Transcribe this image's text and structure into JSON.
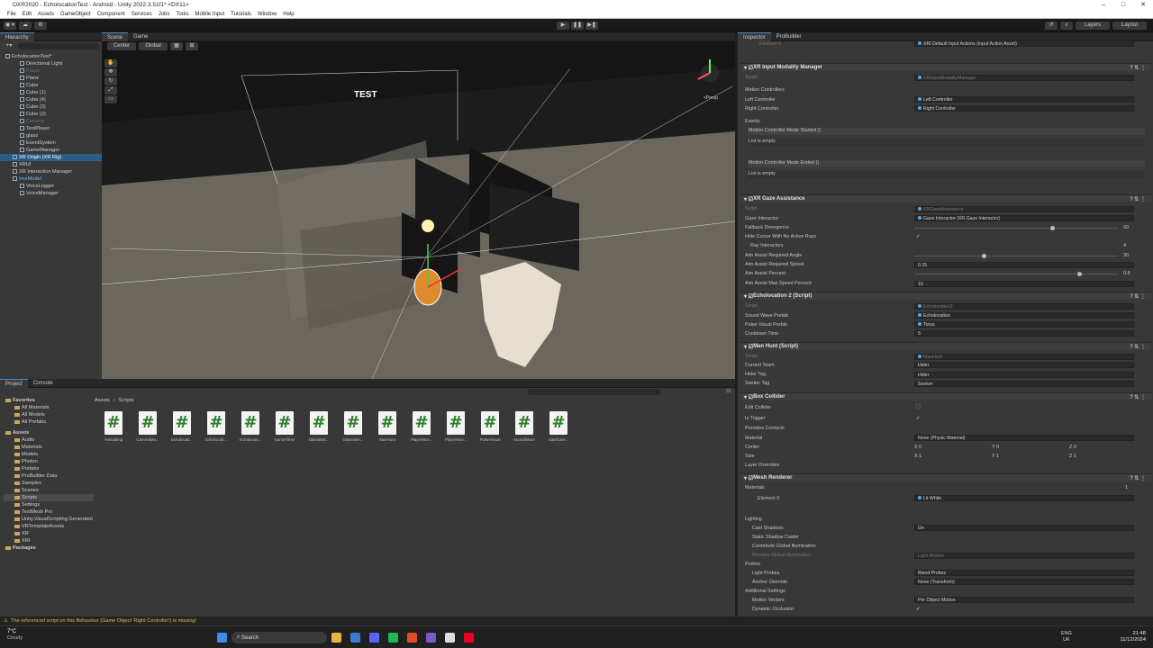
{
  "window": {
    "title": "OXR2020 - EcholocationTest - Android - Unity 2022.3.51f1* <DX11>"
  },
  "menu": [
    "File",
    "Edit",
    "Assets",
    "GameObject",
    "Component",
    "Services",
    "Jobs",
    "Tools",
    "Mobile Input",
    "Tutorials",
    "Window",
    "Help"
  ],
  "toolbar": {
    "layers": "Layers",
    "layout": "Layout"
  },
  "hierarchy": {
    "tab": "Hierarchy",
    "items": [
      {
        "label": "EcholocationTest*",
        "indent": 0,
        "state": "root"
      },
      {
        "label": "Directional Light",
        "indent": 2,
        "state": ""
      },
      {
        "label": "Player",
        "indent": 2,
        "state": "dim"
      },
      {
        "label": "Plane",
        "indent": 2,
        "state": ""
      },
      {
        "label": "Cube",
        "indent": 2,
        "state": ""
      },
      {
        "label": "Cube (1)",
        "indent": 2,
        "state": ""
      },
      {
        "label": "Cube (4)",
        "indent": 2,
        "state": ""
      },
      {
        "label": "Cube (3)",
        "indent": 2,
        "state": ""
      },
      {
        "label": "Cube (2)",
        "indent": 2,
        "state": ""
      },
      {
        "label": "Camera",
        "indent": 2,
        "state": "dim"
      },
      {
        "label": "TestPlayer",
        "indent": 2,
        "state": ""
      },
      {
        "label": "glass",
        "indent": 2,
        "state": ""
      },
      {
        "label": "EventSystem",
        "indent": 2,
        "state": ""
      },
      {
        "label": "GameManager",
        "indent": 2,
        "state": ""
      },
      {
        "label": "XR Origin (XR Rig)",
        "indent": 1,
        "state": "sel"
      },
      {
        "label": "XRUI",
        "indent": 1,
        "state": ""
      },
      {
        "label": "XR Interaction Manager",
        "indent": 1,
        "state": ""
      },
      {
        "label": "treeModel",
        "indent": 1,
        "state": "blue"
      },
      {
        "label": "VoiceLogger",
        "indent": 2,
        "state": ""
      },
      {
        "label": "VoiceManager",
        "indent": 2,
        "state": ""
      }
    ]
  },
  "scene": {
    "tabs": [
      "Scene",
      "Game"
    ],
    "pivot": "Center",
    "space": "Global",
    "persp": "<Persp",
    "label": "TEST"
  },
  "project": {
    "tabs": [
      "Project",
      "Console"
    ],
    "breadcrumb": [
      "Assets",
      "Scripts"
    ],
    "count": "31",
    "favorites": {
      "title": "Favorites",
      "items": [
        "All Materials",
        "All Models",
        "All Prefabs"
      ]
    },
    "assets": {
      "title": "Assets",
      "items": [
        "Audio",
        "Materials",
        "Models",
        "Photon",
        "Prefabs",
        "ProBuilder Data",
        "Samples",
        "Scenes",
        "Scripts",
        "Settings",
        "TextMesh Pro",
        "Unity.VisualScripting.Generated",
        "VRTemplateAssets",
        "XR",
        "XRI"
      ]
    },
    "packages": "Packages",
    "files": [
      "Aimbaiting",
      "CameraMo...",
      "Echolocati...",
      "Echolocati...",
      "Echolocati...",
      "GameTimer",
      "GlassBott...",
      "Glassister...",
      "ManHunt",
      "PlayerMov...",
      "PlayerMov...",
      "PulseVisual",
      "SoundWave",
      "StartGam..."
    ]
  },
  "inspector": {
    "tabs": [
      "Inspector",
      "ProBuilder"
    ],
    "top_element": {
      "label": "Element 0",
      "value": "XRI Default Input Actions (Input Action Asset)"
    },
    "modality": {
      "title": "XR Input Modality Manager",
      "script_label": "Script",
      "script": "XRInputModalityManager",
      "section": "Motion Controllers",
      "left_label": "Left Controller",
      "left": "Left Controller",
      "right_label": "Right Controller",
      "right": "Right Controller",
      "events": "Events",
      "started": "Motion Controller Mode Started ()",
      "empty1": "List is empty",
      "ended": "Motion Controller Mode Ended ()",
      "empty2": "List is empty"
    },
    "gaze": {
      "title": "XR Gaze Assistance",
      "script_label": "Script",
      "script": "XRGazeAssistance",
      "gaze_label": "Gaze Interactor",
      "gaze": "Gaze Interactor (XR Gaze Interactor)",
      "fallback_label": "Fallback Divergence",
      "fallback": "60",
      "hide_label": "Hide Cursor With No Active Rays",
      "rays_label": "Ray Interactors",
      "rays": "4",
      "angle_label": "Aim Assist Required Angle",
      "angle": "30",
      "speed_label": "Aim Assist Required Speed",
      "speed": "0.25",
      "percent_label": "Aim Assist Percent",
      "percent": "0.8",
      "max_label": "Aim Assist Max Speed Percent",
      "max": "10"
    },
    "echo": {
      "title": "Echolocation 2 (Script)",
      "script_label": "Script",
      "script": "Echolocation2",
      "wave_label": "Sound Wave Prefab",
      "wave": "Echolocation",
      "pulse_label": "Pulse Visual Prefab",
      "pulse": "Torus",
      "cool_label": "Cooldown Time",
      "cool": "5"
    },
    "hunt": {
      "title": "Man Hunt (Script)",
      "script_label": "Script",
      "script": "ManHunt",
      "team_label": "Current Team",
      "team": "Hider",
      "hider_label": "Hider Tag",
      "hider": "Hider",
      "seeker_label": "Seeker Tag",
      "seeker": "Seeker"
    },
    "box": {
      "title": "Box Collider",
      "edit_label": "Edit Collider",
      "trigger_label": "Is Trigger",
      "contacts_label": "Provides Contacts",
      "mat_label": "Material",
      "mat": "None (Physic Material)",
      "center_label": "Center",
      "size_label": "Size",
      "layer_label": "Layer Overrides",
      "cx": "X 0",
      "cy": "Y 0",
      "cz": "Z 0",
      "sx": "X 1",
      "sy": "Y 1",
      "sz": "Z 1"
    },
    "mesh": {
      "title": "Mesh Renderer",
      "materials": "Materials",
      "mat_count": "1",
      "el0": "Element 0",
      "lit": "Lit White",
      "lighting": "Lighting",
      "cast_label": "Cast Shadows",
      "cast": "On",
      "static_label": "Static Shadow Caster",
      "gi_label": "Contribute Global Illumination",
      "rgi_label": "Receive Global Illumination",
      "rgi": "Light Probes",
      "probes": "Probes",
      "lp_label": "Light Probes",
      "lp": "Blend Probes",
      "anchor_label": "Anchor Override",
      "anchor": "None (Transform)",
      "add": "Additional Settings",
      "mv_label": "Motion Vectors",
      "mv": "Per Object Motion",
      "occ_label": "Dynamic Occlusion"
    }
  },
  "status": "The referenced script on this Behaviour (Game Object 'Right Controller') is missing!",
  "taskbar": {
    "temp": "7°C",
    "weather": "Cloudy",
    "search": "Search",
    "lang1": "ENG",
    "lang2": "UK",
    "time": "21:48",
    "date": "11/12/2024"
  }
}
